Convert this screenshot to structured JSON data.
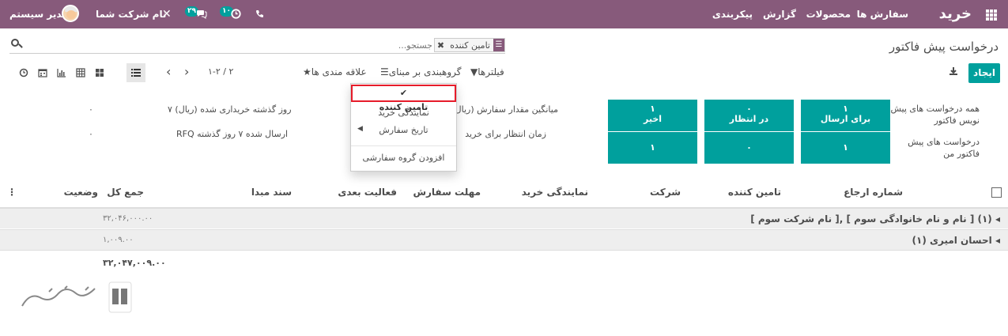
{
  "navbar": {
    "brand": "خرید",
    "menu": [
      "سفارش ها",
      "محصولات",
      "گزارش",
      "پیکربندی"
    ],
    "user_name": "مدیر سیستم",
    "company_name": "نام شرکت شما",
    "activity_badge": "۱۰",
    "message_badge": "۲۹",
    "icons": {
      "apps": "apps-grid-icon",
      "tools": "tools-icon",
      "activity": "clock-icon",
      "messages": "chat-icon",
      "phone": "phone-icon"
    },
    "color": "#875a7b"
  },
  "breadcrumb": "درخواست پیش فاکتور",
  "search": {
    "facet_value": "تامین کننده",
    "placeholder": "جستجو..."
  },
  "buttons": {
    "create": "ایجاد",
    "filters": "فیلترها",
    "group_by": "گروهبندی بر مبنای",
    "favorites": "علاقه مندی ها"
  },
  "pager": "۱-۲ / ۲",
  "groupby_menu": {
    "selected": "تامین کننده",
    "items": [
      "نمایندگی خرید",
      "تاریخ سفارش"
    ],
    "custom": "افزودن گروه سفارشی"
  },
  "dashboard": {
    "row_labels": [
      "همه درخواست های پیش نویس فاکتور",
      "درخواست های پیش فاکتور من"
    ],
    "tiles": [
      {
        "count": "۱",
        "label": "برای ارسال",
        "my_count": "۱"
      },
      {
        "count": "۰",
        "label": "در انتظار",
        "my_count": "۰"
      },
      {
        "count": "۱",
        "label": "اخیر",
        "my_count": "۱"
      }
    ],
    "kpis": [
      {
        "label": "میانگین مقدار سفارش (ریال)",
        "period": "۷ روز گذشته خریداری شده (ریال)",
        "value": "۰"
      },
      {
        "label": "زمان انتظار برای خرید",
        "period": "RFQ ارسال شده ۷ روز گذشته",
        "value": "۰"
      }
    ],
    "tile_color": "#00a09d"
  },
  "list": {
    "columns": [
      "شماره ارجاع",
      "تامین کننده",
      "شرکت",
      "نمایندگی خرید",
      "مهلت سفارش",
      "فعالیت بعدی",
      "سند مبدا",
      "جمع کل",
      "وضعیت"
    ],
    "groups": [
      {
        "label": "[ نام شرکت سوم ], [ نام و نام خانوادگی سوم ] (۱)",
        "total": "۳۲,۰۴۶,۰۰۰.۰۰"
      },
      {
        "label": "احسان امیری (۱)",
        "total": "۱,۰۰۹.۰۰"
      }
    ],
    "grand_total": "۳۲,۰۴۷,۰۰۹.۰۰"
  },
  "watermark": "تهیه گستر"
}
